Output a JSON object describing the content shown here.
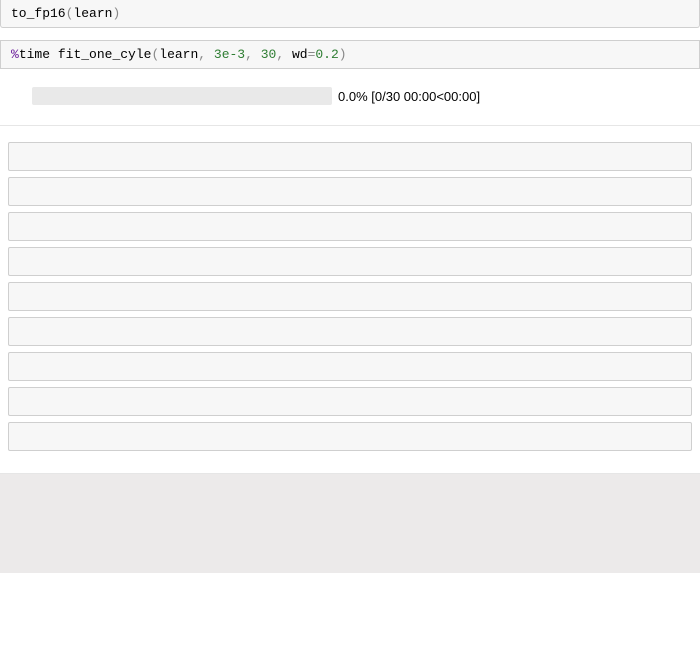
{
  "cells": [
    {
      "tokens": [
        {
          "t": "to_fp16",
          "cls": "tok-fn"
        },
        {
          "t": "(",
          "cls": "tok-paren"
        },
        {
          "t": "learn",
          "cls": "tok-name"
        },
        {
          "t": ")",
          "cls": "tok-paren"
        }
      ]
    },
    {
      "tokens": [
        {
          "t": "%",
          "cls": "tok-magic"
        },
        {
          "t": "time",
          "cls": "tok-fn"
        },
        {
          "t": " ",
          "cls": ""
        },
        {
          "t": "fit_one_cyle",
          "cls": "tok-fn"
        },
        {
          "t": "(",
          "cls": "tok-paren"
        },
        {
          "t": "learn",
          "cls": "tok-name"
        },
        {
          "t": ", ",
          "cls": "tok-comma"
        },
        {
          "t": "3e-3",
          "cls": "tok-num"
        },
        {
          "t": ", ",
          "cls": "tok-comma"
        },
        {
          "t": "30",
          "cls": "tok-num"
        },
        {
          "t": ", ",
          "cls": "tok-comma"
        },
        {
          "t": "wd",
          "cls": "tok-name"
        },
        {
          "t": "=",
          "cls": "tok-op"
        },
        {
          "t": "0.2",
          "cls": "tok-num"
        },
        {
          "t": ")",
          "cls": "tok-paren"
        }
      ]
    }
  ],
  "progress": {
    "percent": "0.0%",
    "detail": "[0/30 00:00<00:00]",
    "fill_width": "0%"
  },
  "empty_cell_count": 9
}
